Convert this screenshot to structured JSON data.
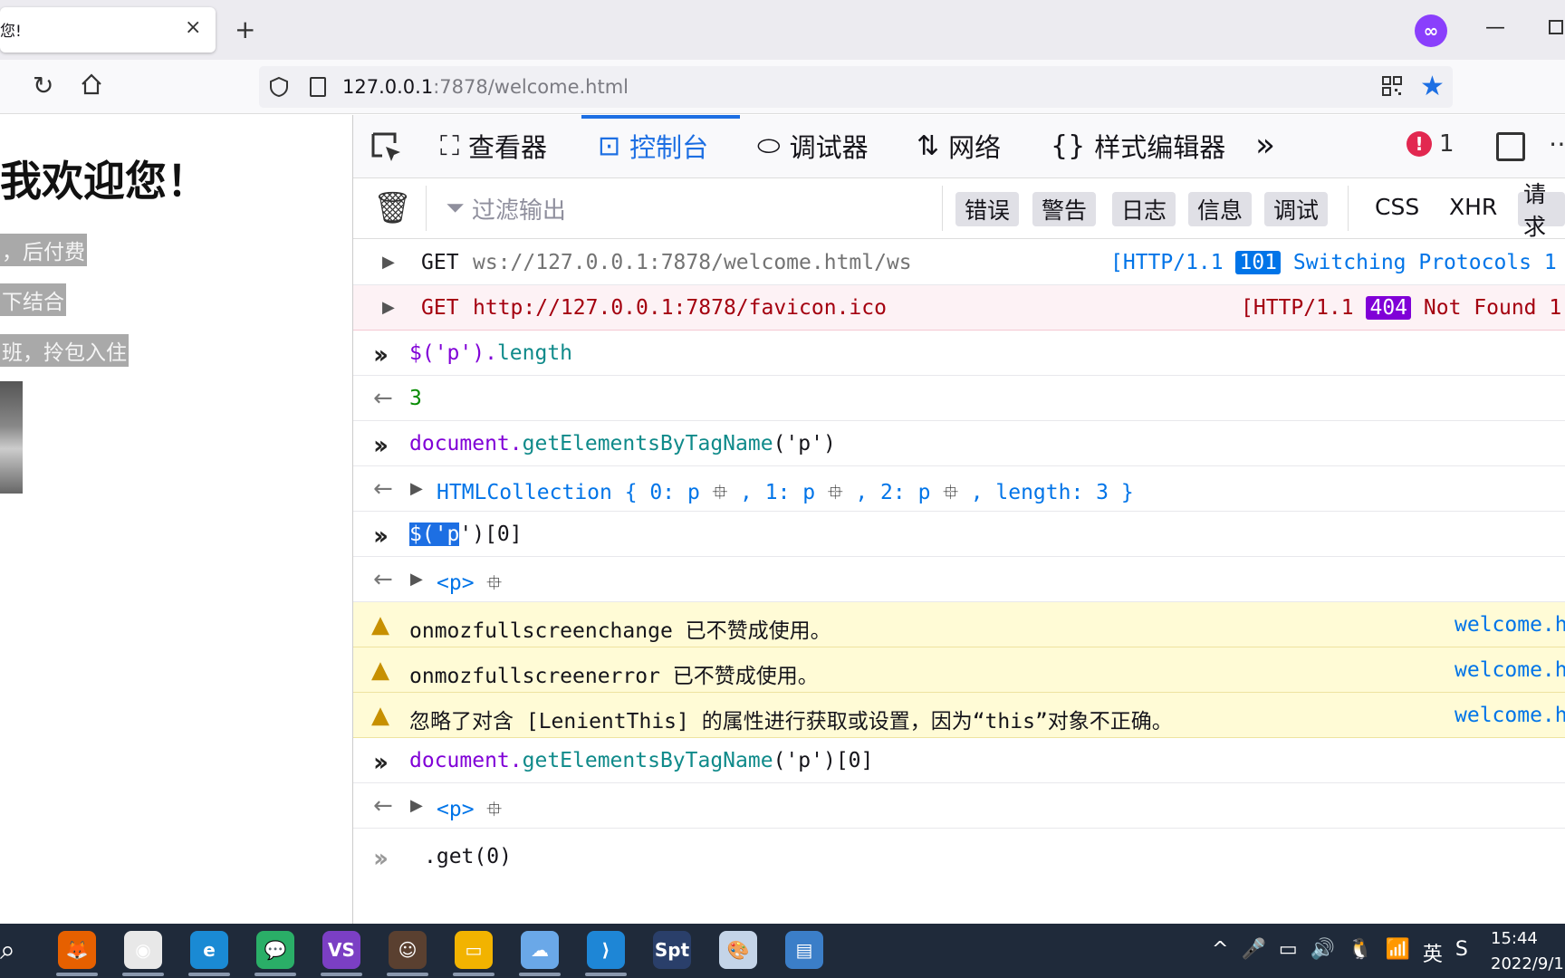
{
  "browser": {
    "tab_title": "您!",
    "tab_close": "×",
    "new_tab": "+",
    "url_host": "127.0.0.1",
    "url_path": ":7878/welcome.html"
  },
  "page": {
    "heading": "我欢迎您！",
    "paragraphs": [
      "，后付费",
      "下结合",
      "班，拎包入住"
    ]
  },
  "devtools": {
    "tabs": [
      {
        "icon": "⬚",
        "label": "查看器"
      },
      {
        "icon": "▷",
        "label": "控制台"
      },
      {
        "icon": "⬯",
        "label": "调试器"
      },
      {
        "icon": "⇅",
        "label": "网络"
      },
      {
        "icon": "{}",
        "label": "样式编辑器"
      }
    ],
    "more": "»",
    "error_count": "1",
    "filter_placeholder": "过滤输出",
    "levels": [
      "错误",
      "警告",
      "日志",
      "信息",
      "调试"
    ],
    "request_types": [
      "CSS",
      "XHR",
      "请求"
    ]
  },
  "console": {
    "net1": {
      "method": "GET",
      "url": "ws://127.0.0.1:7878/welcome.html/ws",
      "proto": "[HTTP/1.1",
      "status": "101",
      "status_text": "Switching Protocols 1"
    },
    "net2": {
      "method": "GET",
      "url": "http://127.0.0.1:7878/favicon.ico",
      "proto": "[HTTP/1.1",
      "status": "404",
      "status_text": "Not Found 1"
    },
    "in1": {
      "a": "$('p').",
      "b": "length"
    },
    "out1": "3",
    "in2": {
      "a": "document.",
      "b": "getElementsByTagName",
      "c": "('p')"
    },
    "out2": {
      "a": "HTMLCollection { 0: p",
      "b": ", 1: p",
      "c": ", 2: p",
      "d": ", length: 3 }"
    },
    "in3": {
      "sel": "$('p",
      "rest": "')[0]"
    },
    "out3": "<p>",
    "warn1": {
      "code": "onmozfullscreenchange",
      "msg": " 已不赞成使用。",
      "src": "welcome.h"
    },
    "warn2": {
      "code": "onmozfullscreenerror",
      "msg": " 已不赞成使用。",
      "src": "welcome.h"
    },
    "warn3": {
      "msg": "忽略了对含 [LenientThis] 的属性进行获取或设置，因为“this”对象不正确。",
      "src": "welcome.h"
    },
    "in4": {
      "a": "document.",
      "b": "getElementsByTagName",
      "c": "('p')[0]"
    },
    "out4": "<p>",
    "input_value": ".get(0)"
  },
  "taskbar": {
    "apps": [
      {
        "name": "firefox",
        "color": "#e66000",
        "glyph": "🦊"
      },
      {
        "name": "chrome",
        "color": "#e8e8e8",
        "glyph": "◉"
      },
      {
        "name": "edge",
        "color": "#1a8ad4",
        "glyph": "e"
      },
      {
        "name": "wechat",
        "color": "#2aae67",
        "glyph": "💬"
      },
      {
        "name": "visual-studio",
        "color": "#7b3fc4",
        "glyph": "VS"
      },
      {
        "name": "app-avatar",
        "color": "#5a4030",
        "glyph": "☺"
      },
      {
        "name": "file-explorer",
        "color": "#f2b300",
        "glyph": "▭"
      },
      {
        "name": "ie-app",
        "color": "#6aa8e8",
        "glyph": "☁"
      },
      {
        "name": "vscode",
        "color": "#1e86d6",
        "glyph": "⟩"
      },
      {
        "name": "spt",
        "color": "#2a3f6a",
        "glyph": "Spt"
      },
      {
        "name": "paint",
        "color": "#c4d4e8",
        "glyph": "🎨"
      },
      {
        "name": "app-window",
        "color": "#3b7ec8",
        "glyph": "▤"
      }
    ],
    "tray": [
      "^",
      "🎤",
      "▭",
      "🔊",
      "🐧",
      "📶",
      "英",
      "S"
    ],
    "time": "15:44",
    "date": "2022/9/1"
  }
}
